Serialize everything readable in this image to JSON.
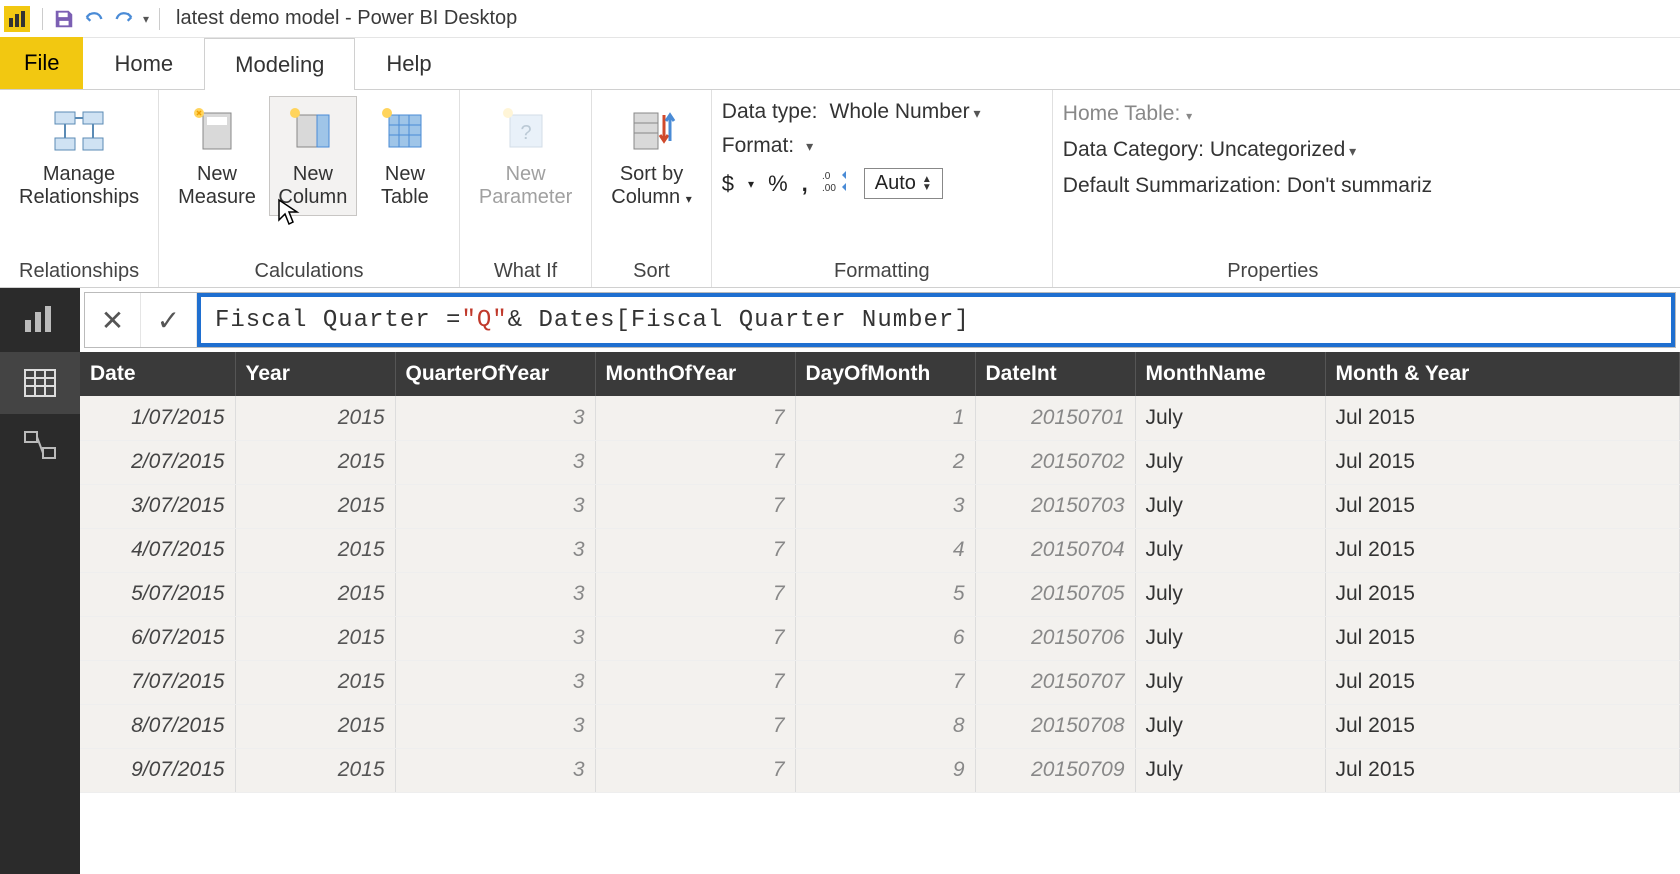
{
  "window_title": "latest demo model - Power BI Desktop",
  "tabs": {
    "file": "File",
    "home": "Home",
    "modeling": "Modeling",
    "help": "Help",
    "active": "Modeling"
  },
  "ribbon": {
    "relationships": {
      "manage": "Manage\nRelationships",
      "group": "Relationships"
    },
    "calculations": {
      "measure": "New\nMeasure",
      "column": "New\nColumn",
      "table": "New\nTable",
      "group": "Calculations"
    },
    "whatif": {
      "parameter": "New\nParameter",
      "group": "What If"
    },
    "sort": {
      "sortby": "Sort by\nColumn",
      "group": "Sort"
    },
    "formatting": {
      "datatype_label": "Data type:",
      "datatype_value": "Whole Number",
      "format_label": "Format:",
      "currency_sym": "$",
      "percent_sym": "%",
      "comma_sym": ",",
      "decimals_icon": ".00",
      "auto_label": "Auto",
      "group": "Formatting"
    },
    "properties": {
      "hometable_label": "Home Table:",
      "datacategory_label": "Data Category:",
      "datacategory_value": "Uncategorized",
      "summarization_label": "Default Summarization:",
      "summarization_value": "Don't summariz",
      "group": "Properties"
    }
  },
  "formula": {
    "prefix": "Fiscal Quarter = ",
    "string": "\"Q\"",
    "suffix": " & Dates[Fiscal Quarter Number]"
  },
  "table": {
    "headers": [
      "Date",
      "Year",
      "QuarterOfYear",
      "MonthOfYear",
      "DayOfMonth",
      "DateInt",
      "MonthName",
      "Month & Year"
    ],
    "rows": [
      {
        "Date": "1/07/2015",
        "Year": "2015",
        "QuarterOfYear": "3",
        "MonthOfYear": "7",
        "DayOfMonth": "1",
        "DateInt": "20150701",
        "MonthName": "July",
        "MonthYear": "Jul 2015"
      },
      {
        "Date": "2/07/2015",
        "Year": "2015",
        "QuarterOfYear": "3",
        "MonthOfYear": "7",
        "DayOfMonth": "2",
        "DateInt": "20150702",
        "MonthName": "July",
        "MonthYear": "Jul 2015"
      },
      {
        "Date": "3/07/2015",
        "Year": "2015",
        "QuarterOfYear": "3",
        "MonthOfYear": "7",
        "DayOfMonth": "3",
        "DateInt": "20150703",
        "MonthName": "July",
        "MonthYear": "Jul 2015"
      },
      {
        "Date": "4/07/2015",
        "Year": "2015",
        "QuarterOfYear": "3",
        "MonthOfYear": "7",
        "DayOfMonth": "4",
        "DateInt": "20150704",
        "MonthName": "July",
        "MonthYear": "Jul 2015"
      },
      {
        "Date": "5/07/2015",
        "Year": "2015",
        "QuarterOfYear": "3",
        "MonthOfYear": "7",
        "DayOfMonth": "5",
        "DateInt": "20150705",
        "MonthName": "July",
        "MonthYear": "Jul 2015"
      },
      {
        "Date": "6/07/2015",
        "Year": "2015",
        "QuarterOfYear": "3",
        "MonthOfYear": "7",
        "DayOfMonth": "6",
        "DateInt": "20150706",
        "MonthName": "July",
        "MonthYear": "Jul 2015"
      },
      {
        "Date": "7/07/2015",
        "Year": "2015",
        "QuarterOfYear": "3",
        "MonthOfYear": "7",
        "DayOfMonth": "7",
        "DateInt": "20150707",
        "MonthName": "July",
        "MonthYear": "Jul 2015"
      },
      {
        "Date": "8/07/2015",
        "Year": "2015",
        "QuarterOfYear": "3",
        "MonthOfYear": "7",
        "DayOfMonth": "8",
        "DateInt": "20150708",
        "MonthName": "July",
        "MonthYear": "Jul 2015"
      },
      {
        "Date": "9/07/2015",
        "Year": "2015",
        "QuarterOfYear": "3",
        "MonthOfYear": "7",
        "DayOfMonth": "9",
        "DateInt": "20150709",
        "MonthName": "July",
        "MonthYear": "Jul 2015"
      }
    ]
  }
}
